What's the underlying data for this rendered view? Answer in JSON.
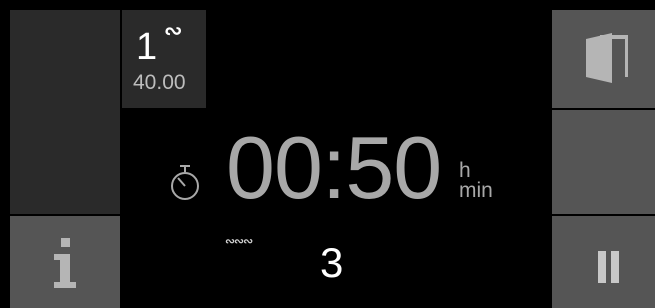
{
  "program": {
    "number": "1",
    "mode_symbol": "∾",
    "value": "40.00"
  },
  "timer": {
    "time": "00:50",
    "unit_hours": "h",
    "unit_minutes": "min"
  },
  "bottom": {
    "mode_symbol": "∾∾∾",
    "value": "3"
  },
  "icons": {
    "door": "door-icon",
    "timer": "stopwatch-icon",
    "info": "info-icon",
    "pause": "pause-icon"
  },
  "colors": {
    "background": "#000000",
    "button_gray": "#555555",
    "panel_dark": "#2a2a2a",
    "timer_text": "#a8a8a8"
  }
}
